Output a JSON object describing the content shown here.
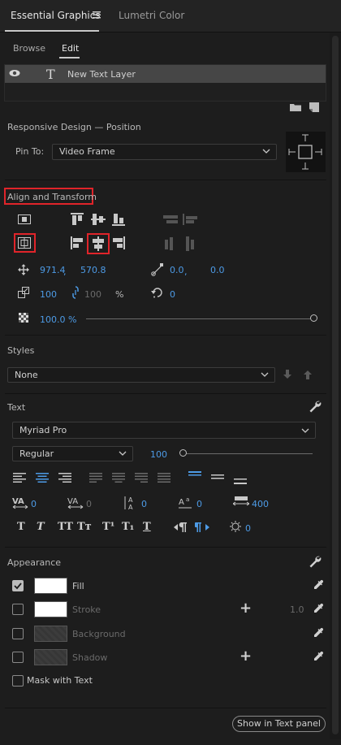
{
  "tabs": {
    "active": "Essential Graphics",
    "menu_icon": "hamburger-icon",
    "second": "Lumetri Color"
  },
  "subtabs": {
    "browse": "Browse",
    "edit": "Edit"
  },
  "layers": [
    {
      "name": "New Text Layer",
      "visible": true
    }
  ],
  "responsive": {
    "title": "Responsive Design — Position",
    "pin_label": "Pin To:",
    "pin_value": "Video Frame"
  },
  "align": {
    "title": "Align and Transform",
    "position": {
      "x": "971.4",
      "sep": ",",
      "y": "570.8"
    },
    "anchor": {
      "x": "0.0",
      "sep": ",",
      "y": "0.0"
    },
    "scale": "100",
    "scale2": "100",
    "scale_unit": "%",
    "rotation": "0",
    "opacity": "100.0 %",
    "opacity_fraction": 1.0
  },
  "styles": {
    "title": "Styles",
    "value": "None"
  },
  "text": {
    "title": "Text",
    "font": "Myriad Pro",
    "style": "Regular",
    "size": "100",
    "size_fraction": 0.0,
    "kerning": "0",
    "tracking": "0",
    "leading": "0",
    "baseline": "0",
    "tsume": "400",
    "tab_width": "0",
    "buttons": [
      "T",
      "T",
      "TT",
      "Tт",
      "T¹",
      "T₁",
      "T"
    ]
  },
  "appearance": {
    "title": "Appearance",
    "fill": "Fill",
    "stroke": "Stroke",
    "stroke_value": "1.0",
    "background": "Background",
    "shadow": "Shadow",
    "mask": "Mask with Text"
  },
  "footer": {
    "button": "Show in Text panel"
  },
  "colors": {
    "accent": "#4d9be6",
    "highlight": "#e0242a",
    "bg": "#1d1d1d"
  }
}
